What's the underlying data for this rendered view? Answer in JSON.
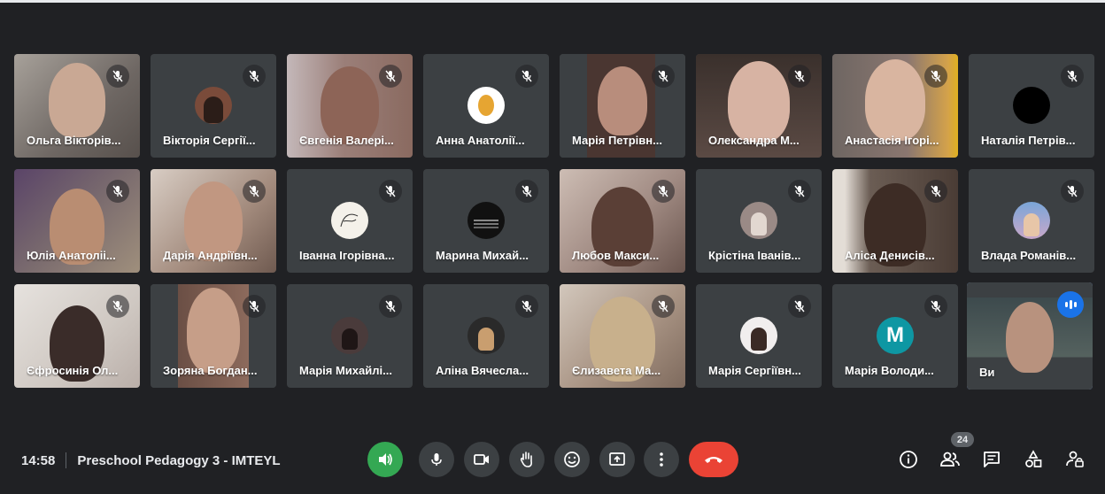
{
  "participants": [
    {
      "name": "Ольга Вікторів..."
    },
    {
      "name": "Вікторія Сергії..."
    },
    {
      "name": "Євгенія Валері..."
    },
    {
      "name": "Анна Анатолії..."
    },
    {
      "name": "Марія Петрівн..."
    },
    {
      "name": "Олександра М..."
    },
    {
      "name": "Анастасія Ігорі..."
    },
    {
      "name": "Наталія Петрів..."
    },
    {
      "name": "Юлія Анатоліі..."
    },
    {
      "name": "Дарія Андріївн..."
    },
    {
      "name": "Іванна Ігорівна..."
    },
    {
      "name": "Марина Михай..."
    },
    {
      "name": "Любов Макси..."
    },
    {
      "name": "Крістіна Іванів..."
    },
    {
      "name": "Аліса Денисів..."
    },
    {
      "name": "Влада Романів..."
    },
    {
      "name": "Єфросинія Ол..."
    },
    {
      "name": "Зоряна Богдан..."
    },
    {
      "name": "Марія Михайлі..."
    },
    {
      "name": "Аліна Вячесла..."
    },
    {
      "name": "Єлизавета Ма..."
    },
    {
      "name": "Марія Сергіївн..."
    },
    {
      "name": "Марія Володи...",
      "initial": "M"
    },
    {
      "name": "Ви"
    }
  ],
  "meeting": {
    "time": "14:58",
    "title": "Preschool Pedagogy 3 - IMTEYL",
    "participant_count": "24"
  },
  "colors": {
    "background": "#202124",
    "tile": "#3c4043",
    "end_call": "#ea4335",
    "audio_active": "#34a853",
    "accent": "#1a73e8",
    "initial_avatar": "#0e97a3"
  }
}
